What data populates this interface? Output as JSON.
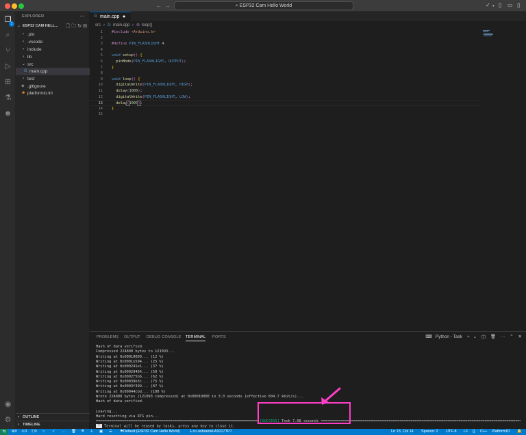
{
  "window": {
    "title": "ESP32 Cam Hello World"
  },
  "sidebar": {
    "title": "EXPLORER",
    "project": "ESP32 CAM HELL...",
    "items": [
      {
        "label": ".pio",
        "type": "folder",
        "expanded": false
      },
      {
        "label": ".vscode",
        "type": "folder",
        "expanded": false
      },
      {
        "label": "include",
        "type": "folder",
        "expanded": false
      },
      {
        "label": "lib",
        "type": "folder",
        "expanded": false
      },
      {
        "label": "src",
        "type": "folder",
        "expanded": true
      },
      {
        "label": "main.cpp",
        "type": "file",
        "selected": true
      },
      {
        "label": "test",
        "type": "folder",
        "expanded": false
      },
      {
        "label": ".gitignore",
        "type": "file"
      },
      {
        "label": "platformio.ini",
        "type": "file"
      }
    ],
    "outline": "OUTLINE",
    "timeline": "TIMELINE"
  },
  "activity_badge": "1",
  "editor": {
    "tab": "main.cpp",
    "breadcrumb": [
      "src",
      "main.cpp",
      "loop()"
    ],
    "current_line": 13,
    "lines": [
      "#include <Arduino.h>",
      "",
      "#define PIN_FLASHLIGHT 4",
      "",
      "void setup() {",
      "  pinMode(PIN_FLASHLIGHT, OUTPUT);",
      "}",
      "",
      "void loop() {",
      "  digitalWrite(PIN_FLASHLIGHT, HIGH);",
      "  delay(1000);",
      "  digitalWrite(PIN_FLASHLIGHT, LOW);",
      "  delay(1000);",
      "}",
      ""
    ]
  },
  "panel": {
    "tabs": [
      "PROBLEMS",
      "OUTPUT",
      "DEBUG CONSOLE",
      "TERMINAL",
      "PORTS"
    ],
    "active_tab": "TERMINAL",
    "task": "Python - Task",
    "terminal": [
      "Hash of data verified.",
      "Compressed 224800 bytes to 121093...",
      "Writing at 0x00010000... (12 %)",
      "Writing at 0x0001e594... (25 %)",
      "Writing at 0x000241e1... (37 %)",
      "Writing at 0x00029464... (50 %)",
      "Writing at 0x0002f5b6... (62 %)",
      "Writing at 0x00039b3c... (75 %)",
      "Writing at 0x0003f399... (87 %)",
      "Writing at 0x00044cbd... (100 %)",
      "Wrote 224800 bytes (121093 compressed) at 0x00010000 in 3.0 seconds (effective 604.7 kbit/s)...",
      "Hash of data verified.",
      "",
      "Leaving...",
      "Hard resetting via RTS pin..."
    ],
    "success_tag": "[SUCCESS]",
    "success_text": "Took 7.08 seconds",
    "rule": "==========================================================================",
    "rule_right": "==================================================================================================",
    "reuse": "Terminal will be reused by tasks, press any key to close it."
  },
  "statusbar": {
    "errors": "0",
    "warnings": "0",
    "info": "0",
    "env": "Default (ESP32 Cam Hello World)",
    "port": "cu.usbserial-A1017TP7",
    "position": "Ln 13, Col 14",
    "spaces": "Spaces: 2",
    "encoding": "UTF-8",
    "eol": "LF",
    "language": "C++",
    "platform": "PlatformIO"
  },
  "colors": {
    "accent": "#007acc",
    "highlight": "#ff3fc8",
    "success": "#0dbc79"
  }
}
